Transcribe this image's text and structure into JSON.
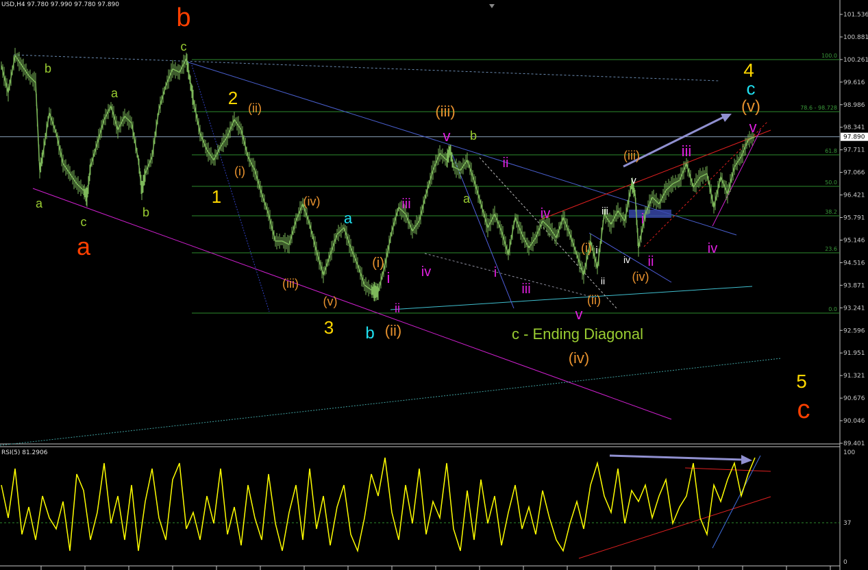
{
  "header": {
    "symbol_info": "USD,H4  97.780 97.990 97.780 97.890"
  },
  "rsi_header": {
    "label": "RSI(5) 81.2906"
  },
  "colors": {
    "background": "#000000",
    "price": "#7db85a",
    "rsi": "#ffff00",
    "fib": "#2e8b2e",
    "price_axis": "#c8c8c8"
  },
  "price_axis_labels": [
    "101.536",
    "100.881",
    "100.261",
    "99.616",
    "98.986",
    "98.341",
    "97.711",
    "97.066",
    "96.421",
    "95.791",
    "95.146",
    "94.516",
    "93.871",
    "93.241",
    "92.596",
    "91.951",
    "91.321",
    "90.676",
    "90.046",
    "89.401"
  ],
  "current_price_label": "97.890",
  "rsi_axis_labels": [
    "100",
    "37",
    "0"
  ],
  "fib_labels": [
    "100.0",
    "78.6 - 98.728",
    "61.8",
    "50.0",
    "38.2",
    "23.6",
    "0.0"
  ],
  "wave_labels": [
    {
      "text": "b",
      "color": "#ff4000"
    },
    {
      "text": "a",
      "color": "#ff4000"
    },
    {
      "text": "c",
      "color": "#9acd32"
    },
    {
      "text": "b",
      "color": "#9acd32"
    },
    {
      "text": "a",
      "color": "#9acd32"
    },
    {
      "text": "a",
      "color": "#9acd32"
    },
    {
      "text": "c",
      "color": "#9acd32"
    },
    {
      "text": "b",
      "color": "#9acd32"
    },
    {
      "text": "2",
      "color": "#ffd700"
    },
    {
      "text": "1",
      "color": "#ffd700"
    },
    {
      "text": "3",
      "color": "#ffd700"
    },
    {
      "text": "4",
      "color": "#ffd700"
    },
    {
      "text": "5",
      "color": "#ffd700"
    },
    {
      "text": "c",
      "color": "#ff4000"
    },
    {
      "text": "(ii)",
      "color": "#e8922e"
    },
    {
      "text": "(i)",
      "color": "#e8922e"
    },
    {
      "text": "(iii)",
      "color": "#e8922e"
    },
    {
      "text": "(iv)",
      "color": "#e8922e"
    },
    {
      "text": "(v)",
      "color": "#e8922e"
    },
    {
      "text": "a",
      "color": "#20e0f0"
    },
    {
      "text": "b",
      "color": "#20e0f0"
    },
    {
      "text": "(i)",
      "color": "#e8922e"
    },
    {
      "text": "(ii)",
      "color": "#e8922e"
    },
    {
      "text": "i",
      "color": "#e020e0"
    },
    {
      "text": "ii",
      "color": "#e020e0"
    },
    {
      "text": "iii",
      "color": "#e020e0"
    },
    {
      "text": "iv",
      "color": "#e020e0"
    },
    {
      "text": "(iii)",
      "color": "#e8922e"
    },
    {
      "text": "v",
      "color": "#e020e0"
    },
    {
      "text": "b",
      "color": "#9acd32"
    },
    {
      "text": "a",
      "color": "#9acd32"
    },
    {
      "text": "ii",
      "color": "#e020e0"
    },
    {
      "text": "i",
      "color": "#e020e0"
    },
    {
      "text": "iii",
      "color": "#e020e0"
    },
    {
      "text": "iv",
      "color": "#e020e0"
    },
    {
      "text": "v",
      "color": "#e020e0"
    },
    {
      "text": "c - Ending Diagonal",
      "color": "#9acd32"
    },
    {
      "text": "(iv)",
      "color": "#e8922e"
    },
    {
      "text": "(i)",
      "color": "#e8922e"
    },
    {
      "text": "i",
      "color": "#ffffff"
    },
    {
      "text": "ii",
      "color": "#ffffff"
    },
    {
      "text": "(ii)",
      "color": "#e8922e"
    },
    {
      "text": "iii",
      "color": "#ffffff"
    },
    {
      "text": "iv",
      "color": "#ffffff"
    },
    {
      "text": "(iv)",
      "color": "#e8922e"
    },
    {
      "text": "v",
      "color": "#ffffff"
    },
    {
      "text": "(iii)",
      "color": "#e8922e"
    },
    {
      "text": "i",
      "color": "#e020e0"
    },
    {
      "text": "ii",
      "color": "#e020e0"
    },
    {
      "text": "iii",
      "color": "#e020e0"
    },
    {
      "text": "iv",
      "color": "#e020e0"
    },
    {
      "text": "v",
      "color": "#e020e0"
    },
    {
      "text": "c",
      "color": "#20e0f0"
    },
    {
      "text": "(v)",
      "color": "#e8922e"
    }
  ],
  "chart_data": [
    {
      "type": "line",
      "series": [
        {
          "x": [
            0,
            10,
            20,
            30,
            40,
            50,
            56,
            60,
            70,
            80,
            90,
            100,
            110,
            120,
            125,
            130,
            140,
            150,
            160,
            170,
            180,
            190,
            200,
            205,
            210,
            220,
            230,
            240,
            250,
            260,
            270,
            275,
            280,
            290,
            300,
            310,
            320,
            330,
            340,
            350,
            360,
            370,
            380,
            390,
            400,
            410,
            420,
            430,
            440,
            450,
            460,
            470,
            480,
            490,
            500,
            510,
            520,
            530,
            540,
            545,
            550,
            560,
            570,
            580,
            590,
            600,
            610,
            620,
            630,
            640,
            650,
            655,
            660,
            670,
            680,
            690,
            700,
            710,
            720,
            730,
            740,
            750,
            760,
            770,
            780,
            790,
            800,
            810,
            820,
            830,
            840,
            850,
            860,
            870,
            880,
            890,
            900,
            910,
            920,
            925,
            930,
            940,
            950,
            960,
            970,
            980,
            990,
            1000,
            1010,
            1020,
            1030,
            1040,
            1050,
            1060,
            1070,
            1080,
            1090,
            1100
          ],
          "y": [
            100.0,
            99.2,
            100.3,
            100.0,
            99.7,
            99.5,
            96.9,
            97.3,
            98.6,
            98.0,
            97.1,
            96.8,
            96.5,
            96.3,
            96.1,
            97.0,
            97.7,
            98.4,
            98.8,
            98.1,
            98.5,
            98.3,
            97.2,
            96.3,
            96.8,
            97.3,
            98.7,
            99.4,
            99.9,
            99.8,
            100.2,
            99.6,
            99.0,
            98.0,
            97.5,
            97.2,
            97.6,
            97.9,
            98.4,
            98.1,
            97.3,
            96.9,
            96.2,
            95.6,
            94.8,
            94.8,
            94.7,
            95.4,
            95.9,
            95.3,
            94.5,
            93.8,
            94.4,
            95.0,
            95.2,
            94.6,
            94.1,
            93.5,
            93.35,
            93.3,
            93.3,
            94.1,
            95.1,
            95.8,
            95.6,
            95.1,
            95.4,
            96.2,
            96.9,
            97.4,
            97.2,
            97.5,
            97.0,
            96.9,
            97.2,
            96.6,
            95.9,
            95.2,
            95.6,
            95.1,
            94.4,
            95.5,
            95.0,
            94.6,
            94.9,
            95.4,
            95.2,
            94.9,
            95.5,
            95.0,
            94.4,
            93.8,
            94.8,
            94.0,
            95.6,
            95.3,
            95.7,
            95.4,
            96.5,
            96.2,
            94.6,
            95.6,
            96.1,
            95.9,
            96.3,
            96.5,
            96.6,
            97.1,
            96.4,
            96.7,
            96.8,
            95.8,
            96.7,
            96.2,
            97.0,
            97.3,
            97.8,
            97.89
          ],
          "color": "#7db85a"
        }
      ],
      "ylim": [
        89.401,
        101.536
      ],
      "grid": false
    },
    {
      "type": "line",
      "series": [
        {
          "x": [
            0,
            10,
            20,
            30,
            40,
            50,
            60,
            70,
            80,
            90,
            100,
            110,
            120,
            130,
            140,
            150,
            160,
            170,
            180,
            190,
            200,
            210,
            220,
            230,
            240,
            250,
            260,
            270,
            280,
            290,
            300,
            310,
            320,
            330,
            340,
            350,
            360,
            370,
            380,
            390,
            400,
            410,
            420,
            430,
            440,
            450,
            460,
            470,
            480,
            490,
            500,
            510,
            520,
            530,
            540,
            550,
            560,
            570,
            580,
            590,
            600,
            610,
            620,
            630,
            640,
            650,
            660,
            670,
            680,
            690,
            700,
            710,
            720,
            730,
            740,
            750,
            760,
            770,
            780,
            790,
            800,
            810,
            820,
            830,
            840,
            850,
            860,
            870,
            880,
            890,
            900,
            910,
            920,
            930,
            940,
            950,
            960,
            970,
            980,
            990,
            1000,
            1010,
            1020,
            1030,
            1040,
            1050,
            1060,
            1070,
            1080,
            1090,
            1100
          ],
          "y": [
            70,
            40,
            85,
            25,
            50,
            20,
            60,
            40,
            30,
            55,
            10,
            80,
            65,
            20,
            45,
            90,
            35,
            60,
            20,
            70,
            10,
            55,
            85,
            40,
            20,
            75,
            90,
            30,
            45,
            20,
            60,
            35,
            85,
            25,
            50,
            15,
            70,
            40,
            20,
            80,
            35,
            10,
            45,
            70,
            20,
            85,
            30,
            60,
            15,
            50,
            70,
            25,
            10,
            40,
            80,
            60,
            95,
            45,
            20,
            70,
            35,
            85,
            25,
            55,
            40,
            90,
            30,
            10,
            65,
            20,
            75,
            35,
            60,
            15,
            45,
            70,
            30,
            50,
            25,
            65,
            40,
            20,
            10,
            35,
            55,
            30,
            70,
            90,
            60,
            45,
            85,
            35,
            65,
            55,
            70,
            40,
            60,
            75,
            35,
            50,
            60,
            90,
            40,
            25,
            70,
            55,
            75,
            90,
            60,
            80,
            95
          ],
          "color": "#ffff00"
        }
      ],
      "ylim": [
        0,
        100
      ],
      "ylabel": ""
    }
  ]
}
